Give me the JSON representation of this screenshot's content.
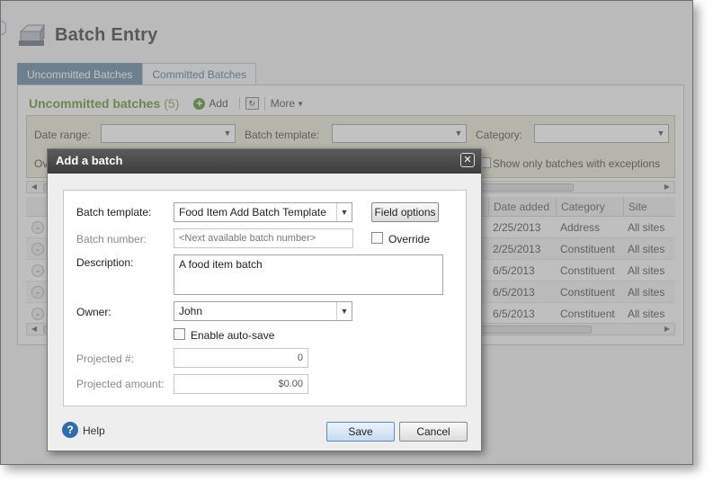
{
  "page": {
    "title": "Batch Entry",
    "tabs": [
      {
        "label": "Uncommitted Batches",
        "active": true
      },
      {
        "label": "Committed Batches",
        "active": false
      }
    ]
  },
  "panel": {
    "title": "Uncommitted batches",
    "count": "(5)",
    "add_label": "Add",
    "more_label": "More"
  },
  "filters": {
    "date_range_label": "Date range:",
    "batch_template_label": "Batch template:",
    "category_label": "Category:",
    "exceptions_label": "Show only batches with exceptions",
    "partial_left_label": "Ov"
  },
  "grid": {
    "columns": [
      "Date added",
      "Category",
      "Site"
    ],
    "rows": [
      {
        "date": "2/25/2013",
        "category": "Address",
        "site": "All sites"
      },
      {
        "date": "2/25/2013",
        "category": "Constituent",
        "site": "All sites"
      },
      {
        "date": "6/5/2013",
        "category": "Constituent",
        "site": "All sites"
      },
      {
        "date": "6/5/2013",
        "category": "Constituent",
        "site": "All sites"
      },
      {
        "date": "6/5/2013",
        "category": "Constituent",
        "site": "All sites"
      }
    ]
  },
  "dialog": {
    "title": "Add a batch",
    "close_glyph": "✕",
    "batch_template_label": "Batch template:",
    "batch_template_value": "Food Item Add Batch Template",
    "field_options_label": "Field options",
    "batch_number_label": "Batch number:",
    "batch_number_placeholder": "<Next available batch number>",
    "override_label": "Override",
    "description_label": "Description:",
    "description_value": "A food item batch",
    "owner_label": "Owner:",
    "owner_value": "John",
    "auto_save_label": "Enable auto-save",
    "projected_count_label": "Projected #:",
    "projected_count_value": "0",
    "projected_amount_label": "Projected amount:",
    "projected_amount_value": "$0.00",
    "help_label": "Help",
    "save_label": "Save",
    "cancel_label": "Cancel"
  },
  "colors": {
    "tab_active": "#6f8ea8",
    "panel_title": "#6a9a3a",
    "dialog_titlebar": "#3d3d3d",
    "help_icon": "#2f6db0",
    "save_button": "#c7dcef"
  }
}
